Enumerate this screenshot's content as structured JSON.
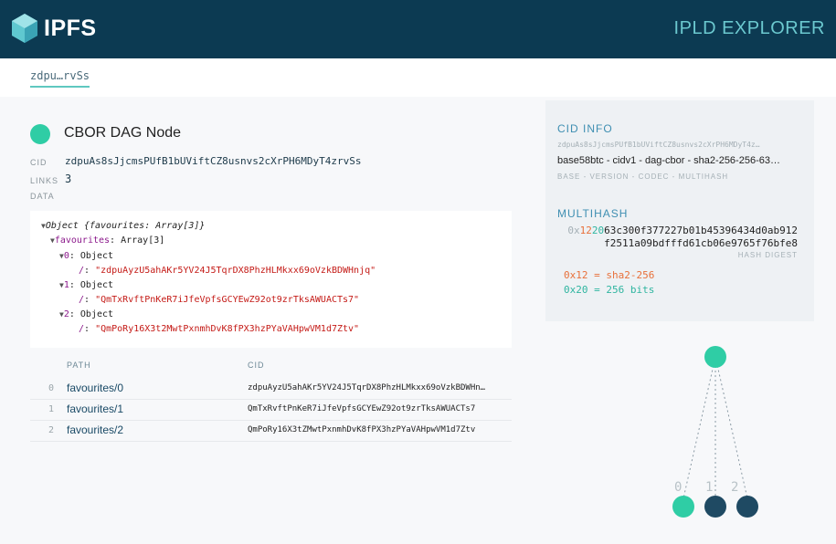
{
  "header": {
    "logo_text": "IPFS",
    "app_title": "IPLD EXPLORER"
  },
  "breadcrumb": {
    "label": "zdpu…rvSs"
  },
  "node": {
    "title": "CBOR DAG Node",
    "cid_label": "CID",
    "cid": "zdpuAs8sJjcmsPUfB1bUViftCZ8usnvs2cXrPH6MDyT4zrvSs",
    "links_label": "LINKS",
    "links_count": "3",
    "data_label": "DATA"
  },
  "data_tree": {
    "root": "Object {favourites: Array[3]}",
    "fav_key": "favourites",
    "fav_val": "Array[3]",
    "items": [
      {
        "key": "0",
        "type": "Object",
        "slash_key": "/",
        "cid": "\"zdpuAyzU5ahAKr5YV24J5TqrDX8PhzHLMkxx69oVzkBDWHnjq\""
      },
      {
        "key": "1",
        "type": "Object",
        "slash_key": "/",
        "cid": "\"QmTxRvftPnKeR7iJfeVpfsGCYEwZ92ot9zrTksAWUACTs7\""
      },
      {
        "key": "2",
        "type": "Object",
        "slash_key": "/",
        "cid": "\"QmPoRy16X3t2MwtPxnmhDvK8fPX3hzPYaVAHpwVM1d7Ztv\""
      }
    ]
  },
  "links_table": {
    "headers": {
      "path": "PATH",
      "cid": "CID"
    },
    "rows": [
      {
        "index": "0",
        "path": "favourites/0",
        "cid": "zdpuAyzU5ahAKr5YV24J5TqrDX8PhzHLMkxx69oVzkBDWHn…"
      },
      {
        "index": "1",
        "path": "favourites/1",
        "cid": "QmTxRvftPnKeR7iJfeVpfsGCYEwZ92ot9zrTksAWUACTs7"
      },
      {
        "index": "2",
        "path": "favourites/2",
        "cid": "QmPoRy16X3tZMwtPxnmhDvK8fPX3hzPYaVAHpwVM1d7Ztv"
      }
    ]
  },
  "cid_info": {
    "title": "CID INFO",
    "cid": "zdpuAs8sJjcmsPUfB1bUViftCZ8usnvs2cXrPH6MDyT4z…",
    "decoded": "base58btc - cidv1 - dag-cbor - sha2-256-256-63…",
    "legend": "BASE - VERSION - CODEC - MULTIHASH",
    "multihash_title": "MULTIHASH",
    "hash_prefix": "0x",
    "hash_code": "12",
    "hash_len": "20",
    "hash_line1_rest": "63c300f377227b01b45396434d0ab912",
    "hash_line2": "f2511a09bdfffd61cb06e9765f76bfe8",
    "hash_digest_label": "HASH DIGEST",
    "code_line": "0x12 = sha2-256",
    "len_line": "0x20 = 256 bits"
  },
  "graph": {
    "labels": [
      "0",
      "1",
      "2"
    ]
  },
  "colors": {
    "header_bg": "#0c3a52",
    "accent": "#2fcda5",
    "link_node": "#1f4a63",
    "title_accent": "#6bc8cf"
  }
}
